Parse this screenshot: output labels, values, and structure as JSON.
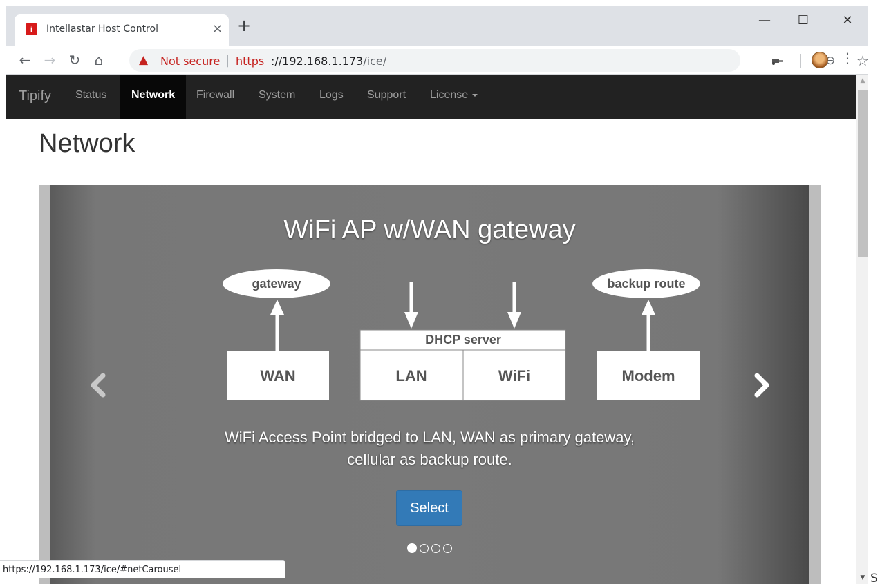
{
  "browser": {
    "tab_title": "Intellastar Host Control",
    "tab_favicon": "i",
    "tab_close": "×",
    "new_tab": "+",
    "window_controls": {
      "minimize": "—",
      "maximize": "☐",
      "close": "✕"
    },
    "security_label": "Not secure",
    "url_scheme": "https",
    "url_rest_host": "://192.168.1.173",
    "url_rest_path": "/ice/",
    "status_url": "https://192.168.1.173/ice/#netCarousel"
  },
  "navbar": {
    "brand": "Tipify",
    "items": [
      {
        "label": "Status",
        "active": false
      },
      {
        "label": "Network",
        "active": true
      },
      {
        "label": "Firewall",
        "active": false
      },
      {
        "label": "System",
        "active": false
      },
      {
        "label": "Logs",
        "active": false
      },
      {
        "label": "Support",
        "active": false
      },
      {
        "label": "License",
        "active": false,
        "dropdown": true
      }
    ]
  },
  "page": {
    "title": "Network"
  },
  "carousel": {
    "slide": {
      "title": "WiFi AP w/WAN gateway",
      "diagram": {
        "gateway_label": "gateway",
        "backup_label": "backup route",
        "dhcp_label": "DHCP server",
        "wan_label": "WAN",
        "lan_label": "LAN",
        "wifi_label": "WiFi",
        "modem_label": "Modem"
      },
      "caption_line1": "WiFi Access Point bridged to LAN, WAN as primary gateway,",
      "caption_line2": "cellular as backup route.",
      "button_label": "Select"
    },
    "slide_count": 4,
    "active_slide": 1
  },
  "colors": {
    "navbar_bg": "#222222",
    "nav_active_bg": "#080808",
    "button_primary": "#337ab7",
    "warning_red": "#c5221f"
  },
  "edge_text": "S"
}
